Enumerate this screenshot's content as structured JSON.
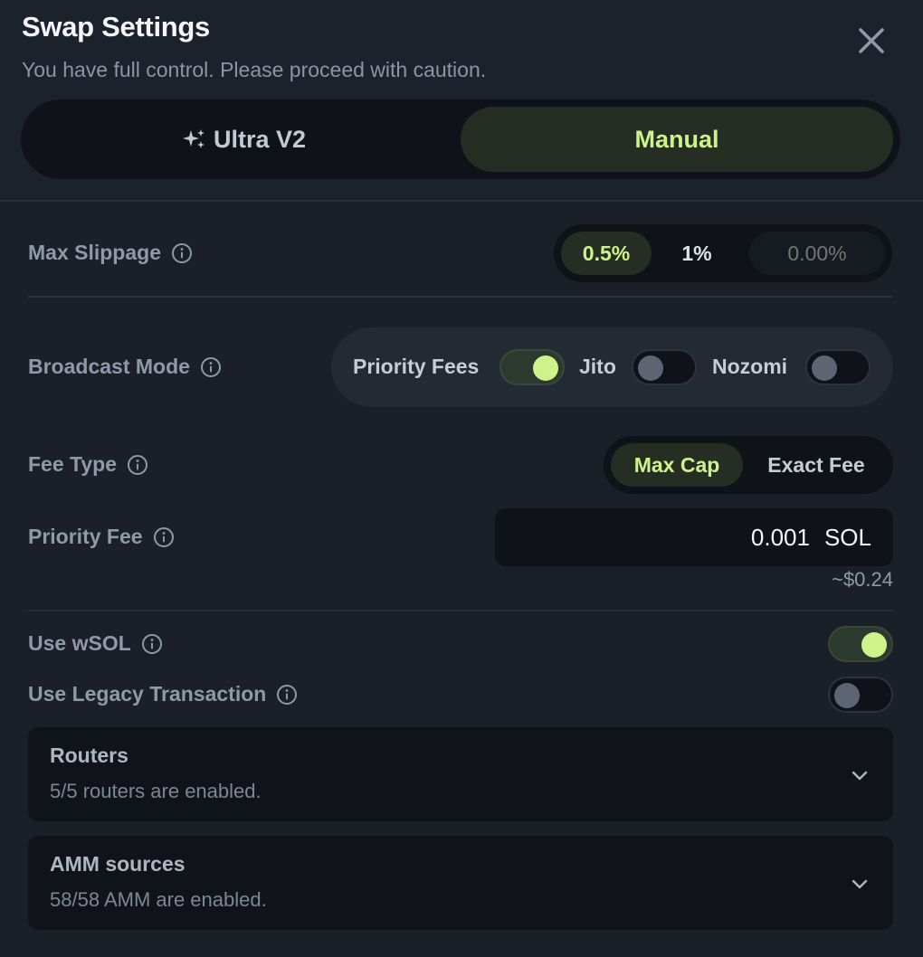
{
  "header": {
    "title": "Swap Settings",
    "subtitle": "You have full control. Please proceed with caution."
  },
  "mode": {
    "ultra_label": "Ultra V2",
    "manual_label": "Manual",
    "selected": "Manual"
  },
  "max_slippage": {
    "label": "Max Slippage",
    "options": [
      "0.5%",
      "1%"
    ],
    "selected": "0.5%",
    "custom_placeholder": "0.00%"
  },
  "broadcast": {
    "label": "Broadcast Mode",
    "priority_fees": {
      "label": "Priority Fees",
      "enabled": true
    },
    "jito": {
      "label": "Jito",
      "enabled": false
    },
    "nozomi": {
      "label": "Nozomi",
      "enabled": false
    }
  },
  "fee_type": {
    "label": "Fee Type",
    "options": [
      "Max Cap",
      "Exact Fee"
    ],
    "selected": "Max Cap"
  },
  "priority_fee": {
    "label": "Priority Fee",
    "value": "0.001",
    "unit": "SOL",
    "usd": "~$0.24"
  },
  "use_wsol": {
    "label": "Use wSOL",
    "enabled": true
  },
  "use_legacy": {
    "label": "Use Legacy Transaction",
    "enabled": false
  },
  "routers": {
    "title": "Routers",
    "subtitle": "5/5 routers are enabled."
  },
  "amm": {
    "title": "AMM sources",
    "subtitle": "58/58 AMM are enabled."
  },
  "colors": {
    "accent": "#cdf38a",
    "background": "#1a1f28",
    "panel": "#0f1319"
  },
  "icons": [
    "close-icon",
    "sparkle-icon",
    "info-icon",
    "chevron-down-icon"
  ]
}
